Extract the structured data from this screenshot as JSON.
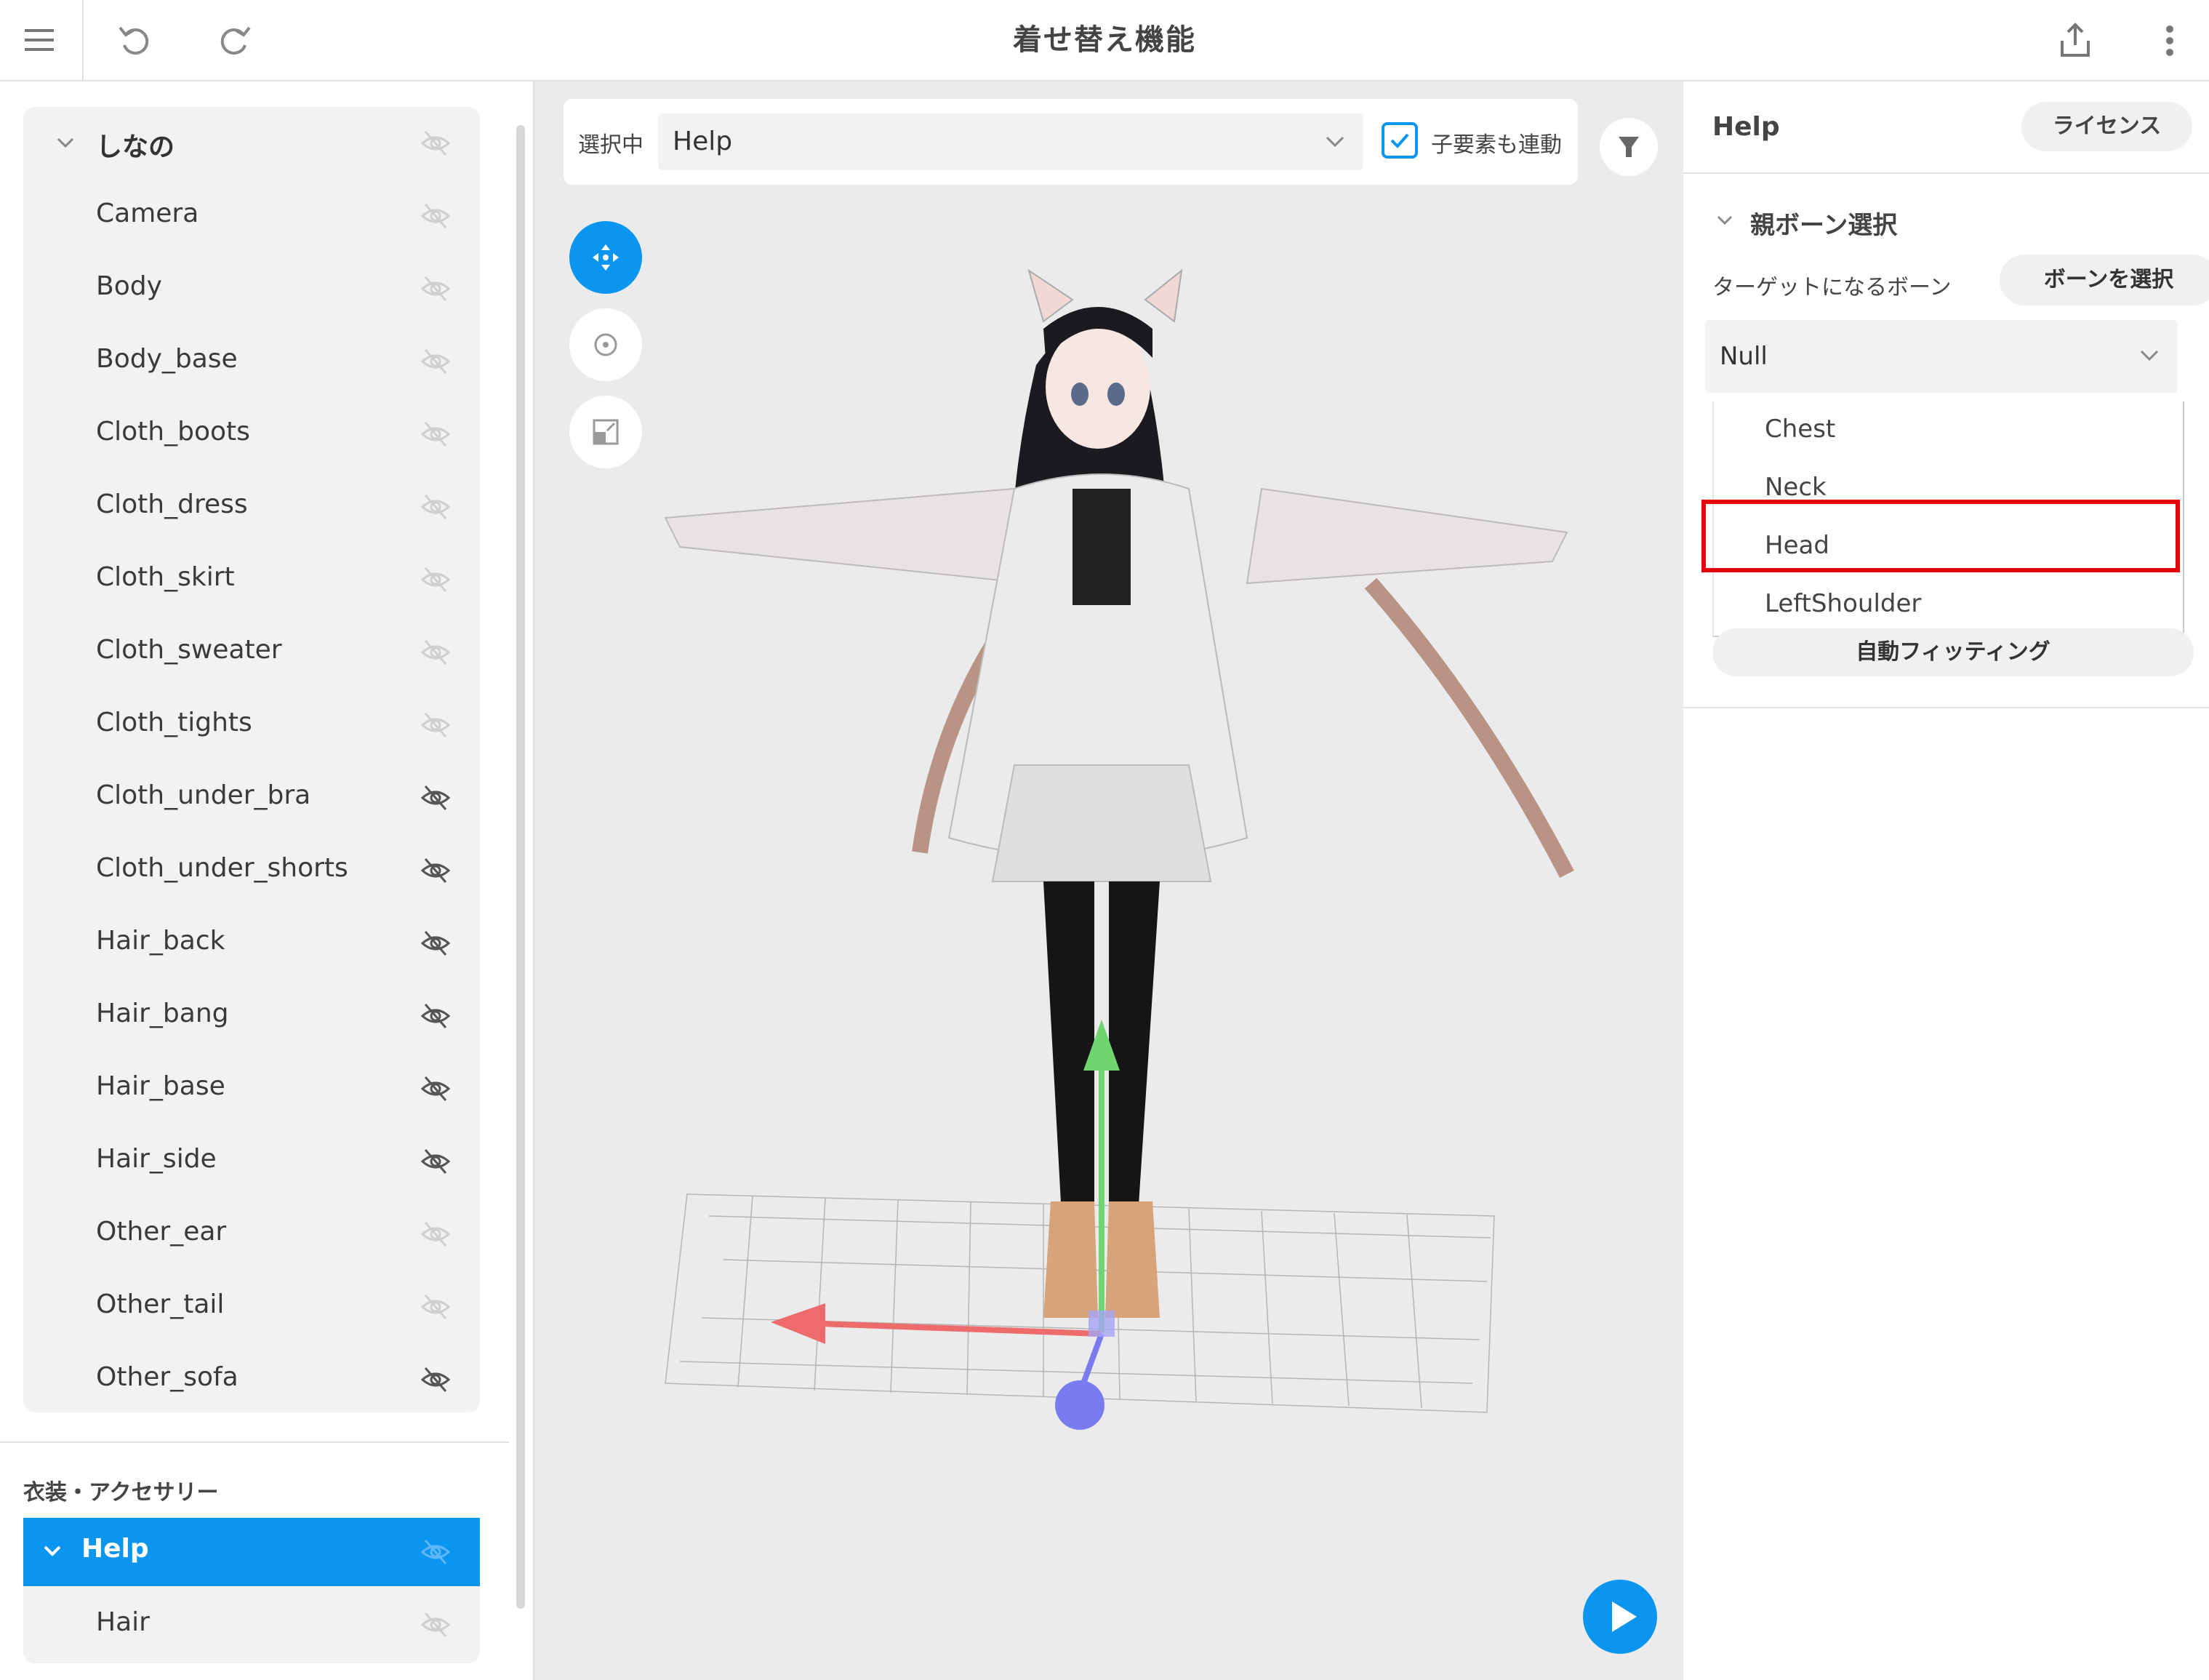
{
  "app": {
    "title": "着せ替え機能",
    "accent_color": "#0a96f0",
    "highlight_color": "#e8000b"
  },
  "topbar": {
    "icons": [
      "menu-icon",
      "undo-icon",
      "redo-icon",
      "share-icon",
      "more-vertical-icon"
    ]
  },
  "left_panel": {
    "group": {
      "label": "しなの"
    },
    "nodes": [
      {
        "label": "Camera",
        "hidden": false
      },
      {
        "label": "Body",
        "hidden": false
      },
      {
        "label": "Body_base",
        "hidden": false
      },
      {
        "label": "Cloth_boots",
        "hidden": false
      },
      {
        "label": "Cloth_dress",
        "hidden": false
      },
      {
        "label": "Cloth_skirt",
        "hidden": false
      },
      {
        "label": "Cloth_sweater",
        "hidden": false
      },
      {
        "label": "Cloth_tights",
        "hidden": false
      },
      {
        "label": "Cloth_under_bra",
        "hidden": true
      },
      {
        "label": "Cloth_under_shorts",
        "hidden": true
      },
      {
        "label": "Hair_back",
        "hidden": true
      },
      {
        "label": "Hair_bang",
        "hidden": true
      },
      {
        "label": "Hair_base",
        "hidden": true
      },
      {
        "label": "Hair_side",
        "hidden": true
      },
      {
        "label": "Other_ear",
        "hidden": false
      },
      {
        "label": "Other_tail",
        "hidden": false
      },
      {
        "label": "Other_sofa",
        "hidden": true
      }
    ],
    "accessory_section": {
      "title": "衣装・アクセサリー",
      "selected": "Help",
      "child": "Hair"
    }
  },
  "viewport": {
    "selection_label": "選択中",
    "selection_value": "Help",
    "link_children_label": "子要素も連動",
    "link_children_checked": true,
    "tools": [
      "move-tool-icon",
      "rotate-tool-icon",
      "scale-tool-icon"
    ]
  },
  "right_panel": {
    "title": "Help",
    "license_button": "ライセンス",
    "bone_section_title": "親ボーン選択",
    "target_bone_label": "ターゲットになるボーン",
    "select_bone_button": "ボーンを選択",
    "current_bone": "Null",
    "bone_options": [
      "Chest",
      "Neck",
      "Head",
      "LeftShoulder"
    ],
    "highlighted_option": "Head",
    "auto_fit_button": "自動フィッティング"
  }
}
